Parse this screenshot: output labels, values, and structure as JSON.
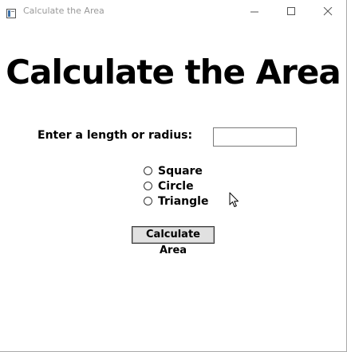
{
  "window": {
    "title": "Calculate the Area",
    "controls": {
      "minimize_icon": "minimize-icon",
      "maximize_icon": "maximize-icon",
      "close_icon": "close-icon"
    }
  },
  "main": {
    "heading": "Calculate the Area",
    "length_label": "Enter a length or radius:",
    "length_value": "",
    "shape_options": [
      {
        "label": "Square",
        "selected": false
      },
      {
        "label": "Circle",
        "selected": false
      },
      {
        "label": "Triangle",
        "selected": false
      }
    ],
    "calculate_button": "Calculate Area"
  },
  "colors": {
    "background": "#ffffff",
    "title_text": "#999999",
    "text": "#000000",
    "button_face": "#e1e1e1"
  }
}
